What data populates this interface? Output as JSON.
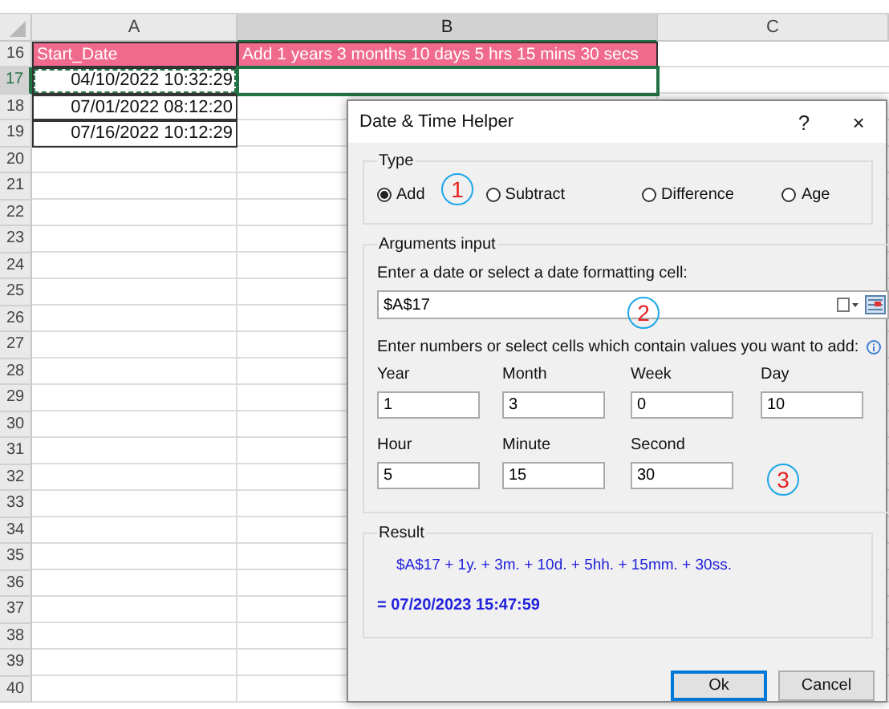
{
  "sheet": {
    "columns": [
      {
        "label": "A",
        "selected": false
      },
      {
        "label": "B",
        "selected": true
      },
      {
        "label": "C",
        "selected": false
      }
    ],
    "rows": [
      {
        "number": "16",
        "selected": false,
        "kind": "header",
        "cells": [
          {
            "text": "Start_Date",
            "selected": false,
            "copied": false
          },
          {
            "text": "Add 1 years 3 months 10 days 5 hrs 15 mins 30 secs",
            "selected": false,
            "copied": false
          }
        ]
      },
      {
        "number": "17",
        "selected": true,
        "kind": "data",
        "cells": [
          {
            "text": "04/10/2022 10:32:29",
            "selected": false,
            "copied": true
          },
          {
            "selected": true,
            "copied": false
          }
        ]
      },
      {
        "number": "18",
        "selected": false,
        "kind": "data",
        "cells": [
          {
            "text": "07/01/2022 08:12:20",
            "selected": false,
            "copied": false
          }
        ]
      },
      {
        "number": "19",
        "selected": false,
        "kind": "data",
        "cells": [
          {
            "text": "07/16/2022 10:12:29",
            "selected": false,
            "copied": false
          }
        ]
      },
      {
        "number": "20",
        "selected": false,
        "kind": "empty"
      },
      {
        "number": "21",
        "selected": false,
        "kind": "empty"
      },
      {
        "number": "22",
        "selected": false,
        "kind": "empty"
      },
      {
        "number": "23",
        "selected": false,
        "kind": "empty"
      },
      {
        "number": "24",
        "selected": false,
        "kind": "empty"
      },
      {
        "number": "25",
        "selected": false,
        "kind": "empty"
      },
      {
        "number": "26",
        "selected": false,
        "kind": "empty"
      },
      {
        "number": "27",
        "selected": false,
        "kind": "empty"
      },
      {
        "number": "28",
        "selected": false,
        "kind": "empty"
      },
      {
        "number": "29",
        "selected": false,
        "kind": "empty"
      },
      {
        "number": "30",
        "selected": false,
        "kind": "empty"
      },
      {
        "number": "31",
        "selected": false,
        "kind": "empty"
      },
      {
        "number": "32",
        "selected": false,
        "kind": "empty"
      },
      {
        "number": "33",
        "selected": false,
        "kind": "empty"
      },
      {
        "number": "34",
        "selected": false,
        "kind": "empty"
      },
      {
        "number": "35",
        "selected": false,
        "kind": "empty"
      },
      {
        "number": "36",
        "selected": false,
        "kind": "empty"
      },
      {
        "number": "37",
        "selected": false,
        "kind": "empty"
      },
      {
        "number": "38",
        "selected": false,
        "kind": "empty"
      },
      {
        "number": "39",
        "selected": false,
        "kind": "empty"
      },
      {
        "number": "40",
        "selected": false,
        "kind": "empty"
      }
    ]
  },
  "dialog": {
    "title": "Date & Time Helper",
    "help": "?",
    "close": "×",
    "type_group": {
      "label": "Type",
      "options": [
        {
          "label": "Add",
          "selected": true
        },
        {
          "label": "Subtract",
          "selected": false
        },
        {
          "label": "Difference",
          "selected": false
        },
        {
          "label": "Age",
          "selected": false
        }
      ]
    },
    "arguments": {
      "label": "Arguments input",
      "date_prompt": "Enter a date or select a date formatting cell:",
      "date_value": "$A$17",
      "numbers_prompt": "Enter numbers or select cells which contain values you want to add:",
      "fields": [
        {
          "label": "Year",
          "value": "1"
        },
        {
          "label": "Month",
          "value": "3"
        },
        {
          "label": "Week",
          "value": "0"
        },
        {
          "label": "Day",
          "value": "10"
        },
        {
          "label": "Hour",
          "value": "5"
        },
        {
          "label": "Minute",
          "value": "15"
        },
        {
          "label": "Second",
          "value": "30"
        }
      ]
    },
    "result": {
      "label": "Result",
      "formula": "$A$17 + 1y. + 3m. + 10d. + 5hh. + 15mm. + 30ss.",
      "value": "= 07/20/2023 15:47:59"
    },
    "buttons": [
      {
        "label": "Ok",
        "focused": true
      },
      {
        "label": "Cancel",
        "focused": false
      }
    ],
    "callouts": [
      {
        "number": "1"
      },
      {
        "number": "2"
      },
      {
        "number": "3"
      }
    ]
  }
}
